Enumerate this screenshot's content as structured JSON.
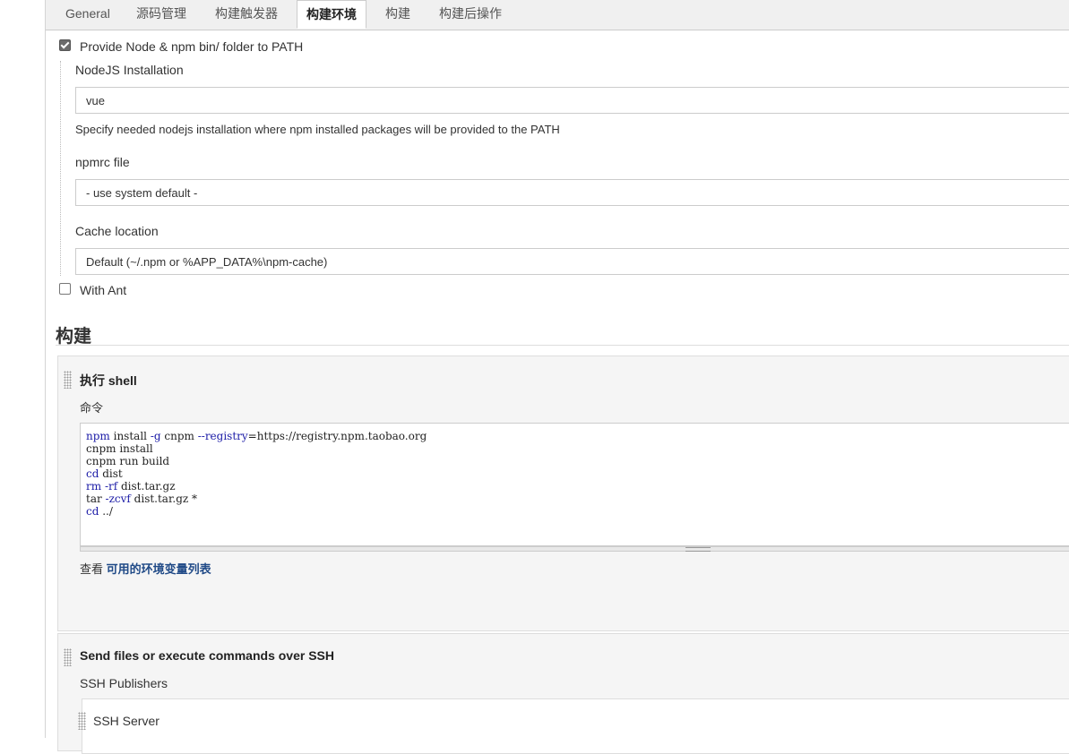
{
  "tabs": [
    "General",
    "源码管理",
    "构建触发器",
    "构建环境",
    "构建",
    "构建后操作"
  ],
  "env": {
    "node_checkbox_label": "Provide Node & npm bin/ folder to PATH",
    "node_checked": true,
    "nodejs_installation_label": "NodeJS Installation",
    "nodejs_installation_value": "vue",
    "nodejs_installation_hint": "Specify needed nodejs installation where npm installed packages will be provided to the PATH",
    "npmrc_label": "npmrc file",
    "npmrc_value": "- use system default -",
    "cache_label": "Cache location",
    "cache_value": "Default (~/.npm or %APP_DATA%\\npm-cache)",
    "ant_label": "With Ant",
    "ant_checked": false
  },
  "build": {
    "section_title": "构建",
    "shell_title": "执行 shell",
    "command_label": "命令",
    "command_lines": [
      "npm install -g cnpm --registry=https://registry.npm.taobao.org",
      "cnpm install",
      "cnpm run build",
      "cd dist",
      "rm -rf dist.tar.gz",
      "tar -zcvf dist.tar.gz *",
      "cd ../"
    ],
    "see_prefix": "查看",
    "env_link": "可用的环境变量列表",
    "ssh_title": "Send files or execute commands over SSH",
    "ssh_publishers_label": "SSH Publishers",
    "ssh_server_label": "SSH Server"
  }
}
